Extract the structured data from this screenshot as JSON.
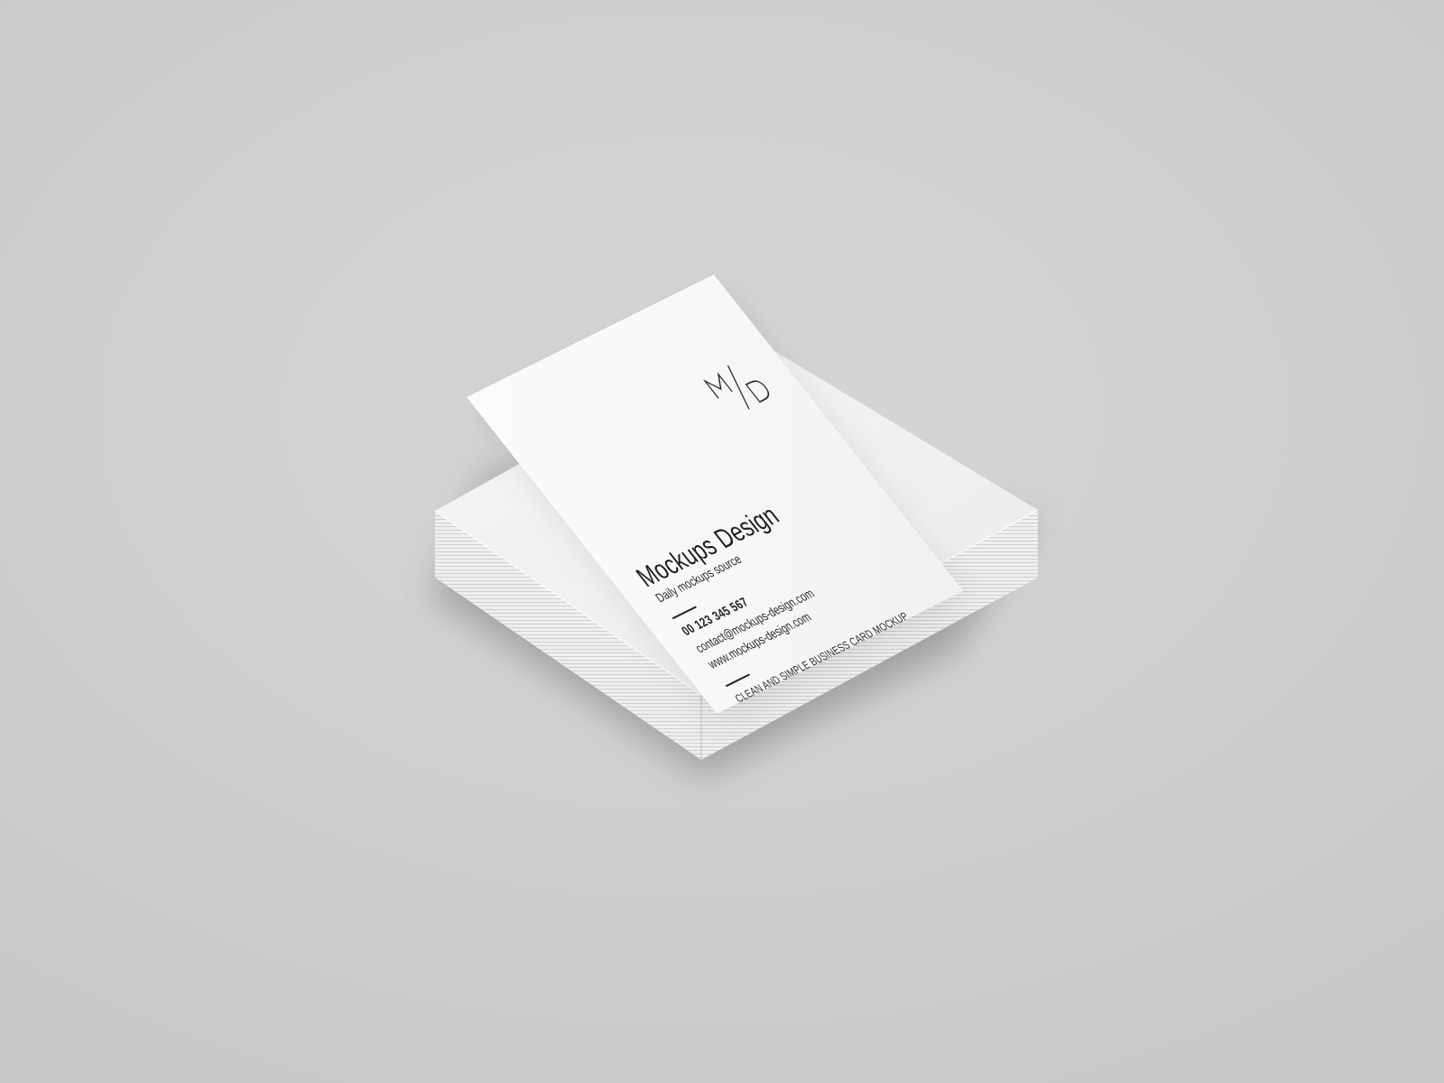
{
  "card": {
    "logo_text": "M/D",
    "company_name": "Mockups Design",
    "tagline": "Daily mockups source",
    "phone": "00 123 345 567",
    "email": "contact@mockups-design.com",
    "website": "www.mockups-design.com",
    "footer_text": "CLEAN AND SIMPLE BUSINESS CARD MOCKUP"
  },
  "colors": {
    "background": "#cfcfcf",
    "card": "#f9f9f8",
    "ink": "#1e1e1e"
  }
}
